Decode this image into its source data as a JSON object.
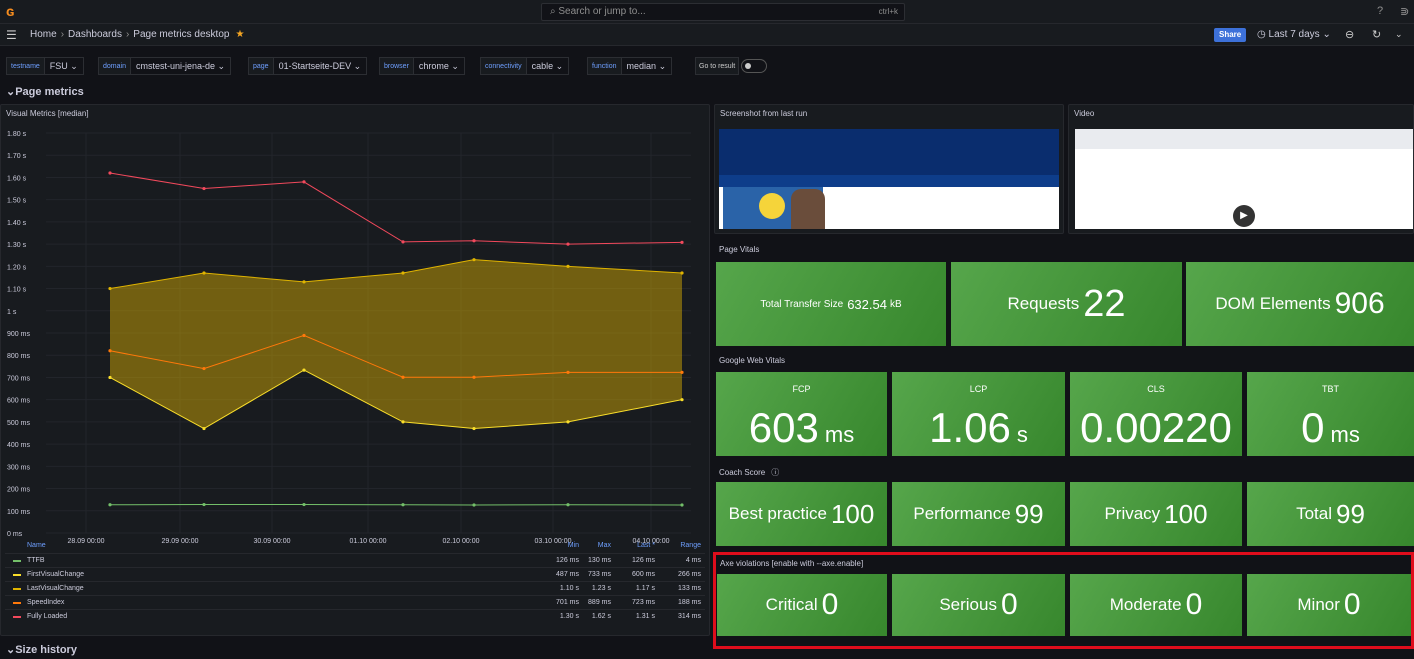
{
  "search": {
    "placeholder": "Search or jump to...",
    "shortcut": "ctrl+k"
  },
  "breadcrumb": {
    "home": "Home",
    "dashboards": "Dashboards",
    "current": "Page metrics desktop"
  },
  "share_label": "Share",
  "time_range": "Last 7 days",
  "variables": [
    {
      "label": "testname",
      "value": "FSU"
    },
    {
      "label": "domain",
      "value": "cmstest-uni-jena-de"
    },
    {
      "label": "page",
      "value": "01-Startseite-DEV"
    },
    {
      "label": "browser",
      "value": "chrome"
    },
    {
      "label": "connectivity",
      "value": "cable"
    },
    {
      "label": "function",
      "value": "median"
    }
  ],
  "go_to_result": "Go to result",
  "rows": {
    "page_metrics": "Page metrics",
    "size_history": "Size history"
  },
  "visual_panel": {
    "title": "Visual Metrics [median]"
  },
  "screenshot_panel": {
    "title": "Screenshot from last run"
  },
  "video_panel": {
    "title": "Video"
  },
  "page_vitals": {
    "title": "Page Vitals",
    "transfer_label": "Total Transfer Size",
    "transfer_value": "632.54",
    "transfer_unit": "kB",
    "requests_label": "Requests",
    "requests_value": "22",
    "dom_label": "DOM Elements",
    "dom_value": "906"
  },
  "web_vitals": {
    "title": "Google Web Vitals",
    "fcp_label": "FCP",
    "fcp_value": "603",
    "fcp_unit": "ms",
    "lcp_label": "LCP",
    "lcp_value": "1.06",
    "lcp_unit": "s",
    "cls_label": "CLS",
    "cls_value": "0.00220",
    "tbt_label": "TBT",
    "tbt_value": "0",
    "tbt_unit": "ms"
  },
  "coach": {
    "title": "Coach Score",
    "best_label": "Best practice",
    "best_value": "100",
    "perf_label": "Performance",
    "perf_value": "99",
    "privacy_label": "Privacy",
    "privacy_value": "100",
    "total_label": "Total",
    "total_value": "99"
  },
  "axe": {
    "title": "Axe violations [enable with --axe.enable]",
    "critical_label": "Critical",
    "critical_value": "0",
    "serious_label": "Serious",
    "serious_value": "0",
    "moderate_label": "Moderate",
    "moderate_value": "0",
    "minor_label": "Minor",
    "minor_value": "0"
  },
  "legend": {
    "headers": {
      "name": "Name",
      "min": "Min",
      "max": "Max",
      "last": "Last *",
      "range": "Range"
    },
    "rows": [
      {
        "name": "TTFB",
        "color": "#73bf69",
        "min": "126 ms",
        "max": "130 ms",
        "last": "126 ms",
        "range": "4 ms"
      },
      {
        "name": "FirstVisualChange",
        "color": "#fade2a",
        "min": "487 ms",
        "max": "733 ms",
        "last": "600 ms",
        "range": "266 ms"
      },
      {
        "name": "LastVisualChange",
        "color": "#e0b400",
        "min": "1.10 s",
        "max": "1.23 s",
        "last": "1.17 s",
        "range": "133 ms"
      },
      {
        "name": "SpeedIndex",
        "color": "#ff780a",
        "min": "701 ms",
        "max": "889 ms",
        "last": "723 ms",
        "range": "188 ms"
      },
      {
        "name": "Fully Loaded",
        "color": "#f2495c",
        "min": "1.30 s",
        "max": "1.62 s",
        "last": "1.31 s",
        "range": "314 ms"
      }
    ]
  },
  "chart_data": {
    "type": "line",
    "title": "Visual Metrics [median]",
    "y_ticks": [
      "1.80 s",
      "1.70 s",
      "1.60 s",
      "1.50 s",
      "1.40 s",
      "1.30 s",
      "1.20 s",
      "1.10 s",
      "1 s",
      "900 ms",
      "800 ms",
      "700 ms",
      "600 ms",
      "500 ms",
      "400 ms",
      "300 ms",
      "200 ms",
      "100 ms",
      "0 ms"
    ],
    "x_ticks": [
      "28.09 00:00",
      "29.09 00:00",
      "30.09 00:00",
      "01.10 00:00",
      "02.10 00:00",
      "03.10 00:00",
      "04.10 00:00"
    ],
    "ylim": [
      0,
      1800
    ],
    "x": [
      0,
      1,
      2,
      3,
      4,
      5,
      6
    ],
    "series": [
      {
        "name": "Fully Loaded",
        "color": "#f2495c",
        "values": [
          1620,
          1550,
          1580,
          1310,
          1315,
          1300,
          1308
        ]
      },
      {
        "name": "LastVisualChange",
        "color": "#e0b400",
        "values": [
          1100,
          1170,
          1130,
          1170,
          1230,
          1200,
          1170
        ]
      },
      {
        "name": "SpeedIndex",
        "color": "#ff780a",
        "values": [
          820,
          740,
          889,
          701,
          701,
          723,
          723
        ]
      },
      {
        "name": "FirstVisualChange",
        "color": "#fade2a",
        "values": [
          700,
          470,
          733,
          500,
          470,
          500,
          600
        ]
      },
      {
        "name": "TTFB",
        "color": "#73bf69",
        "values": [
          127,
          128,
          128,
          127,
          126,
          127,
          126
        ]
      }
    ]
  }
}
